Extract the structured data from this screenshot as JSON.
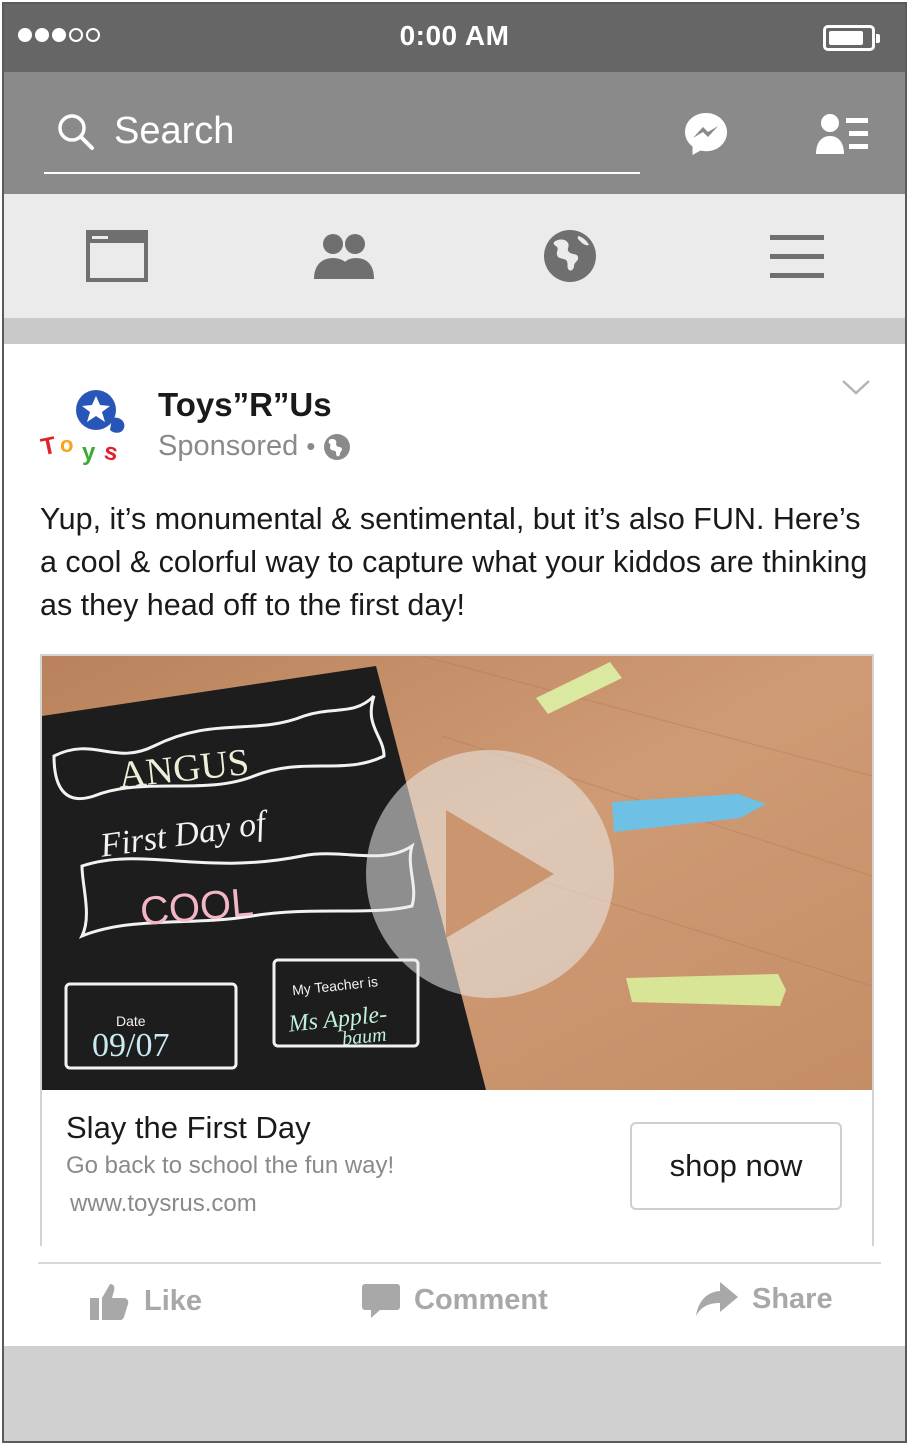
{
  "status_bar": {
    "time": "0:00 AM",
    "signal_bars_filled": 3,
    "signal_bars_total": 5
  },
  "search": {
    "placeholder": "Search"
  },
  "icons": {
    "search": "search-icon",
    "messenger": "messenger-icon",
    "friend_requests": "friend-requests-icon",
    "news_feed": "news-feed-icon",
    "friends": "friends-icon",
    "globe": "globe-icon",
    "menu": "menu-icon"
  },
  "post": {
    "page_name": "Toys”R”Us",
    "sponsored": "Sponsored",
    "separator": "•",
    "text": "Yup, it’s monumental & sentimental, but it’s also FUN. Here’s a cool & colorful way to capture what your kiddos are thinking as they head off to the first day!",
    "video": {
      "banner_name": "ANGUS",
      "line2": "First Day of",
      "line3": "COOL",
      "date_label": "Date",
      "date_value": "09/07",
      "teacher_label": "My Teacher is",
      "teacher_value_1": "Ms Apple-",
      "teacher_value_2": "baum"
    },
    "link": {
      "title": "Slay the First Day",
      "description": "Go back to school the fun way!",
      "url": "www.toysrus.com",
      "cta": "shop now"
    },
    "actions": {
      "like": "Like",
      "comment": "Comment",
      "share": "Share"
    }
  },
  "colors": {
    "status_bar": "#666666",
    "search_bar": "#8a8a8a",
    "nav_bar": "#ebebeb",
    "action_text": "#a8a8a8",
    "table_wood": "#c8926a",
    "chalkboard": "#1d1d1d"
  }
}
